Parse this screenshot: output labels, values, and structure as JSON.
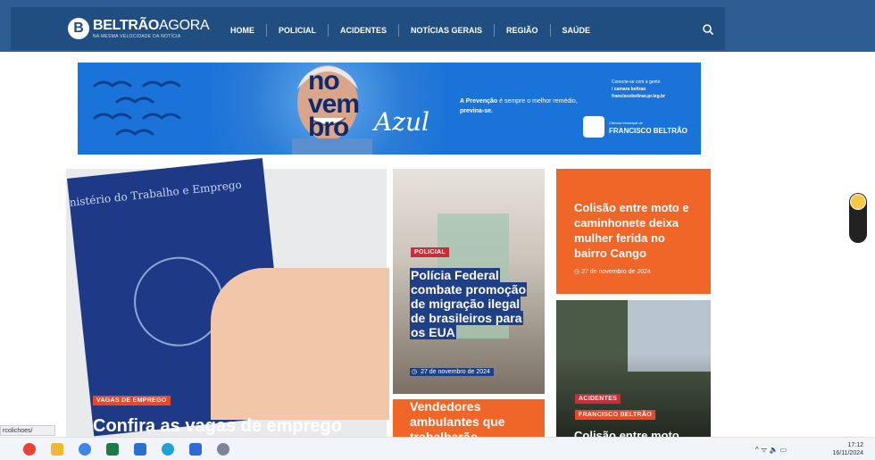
{
  "site": {
    "logo_mark": "B",
    "logo_name_bold": "BELTRÃO",
    "logo_name_rest": "AGORA",
    "logo_tagline": "NA MESMA VELOCIDADE DA NOTÍCIA"
  },
  "nav": {
    "items": [
      "HOME",
      "POLICIAL",
      "ACIDENTES",
      "NOTÍCIAS GERAIS",
      "REGIÃO",
      "SAÚDE"
    ]
  },
  "banner": {
    "word_line1": "no",
    "word_line2": "vem",
    "word_line3": "bro",
    "word_script": "Azul",
    "message_bold": "A Prevenção",
    "message_rest": " é sempre o melhor remédio,",
    "message_end": " previna-se.",
    "connect_line1": "Conecte-se com a gente",
    "connect_handle": "/ camara beltrao",
    "connect_site": "franciscobeltrao.pr.leg.br",
    "camara_small": "Câmara Municipal de",
    "camara_name": "FRANCISCO BELTRÃO"
  },
  "main_story": {
    "passport_text": "nistério do Trabalho e Emprego",
    "tag": "VAGAS DE EMPREGO",
    "title": "Confira as vagas de emprego"
  },
  "police_story": {
    "tag": "POLICIAL",
    "title": "Polícia Federal combate promoção de migração ilegal de brasileiros para os EUA",
    "date": "27 de novembro de 2024"
  },
  "orange_story": {
    "title": "Colisão entre moto e caminhonete deixa mulher ferida no bairro Cango",
    "date": "27 de novembro de 2024"
  },
  "vendors_story": {
    "title": "Vendedores ambulantes que trabalharão"
  },
  "accident_story": {
    "tag1": "ACIDENTES",
    "tag2": "FRANCISCO BELTRÃO",
    "title": "Colisão entre moto"
  },
  "browser": {
    "status_url": "rcolichoes/"
  },
  "taskbar": {
    "time": "17:12",
    "date": "16/11/2024",
    "tray_symbols": "^  ᯤ  🔈  ▭"
  },
  "colors": {
    "nav_bg": "#214e80",
    "banner_blue": "#1a73d8",
    "orange": "#f06528",
    "tag_red": "#c42f3a"
  }
}
